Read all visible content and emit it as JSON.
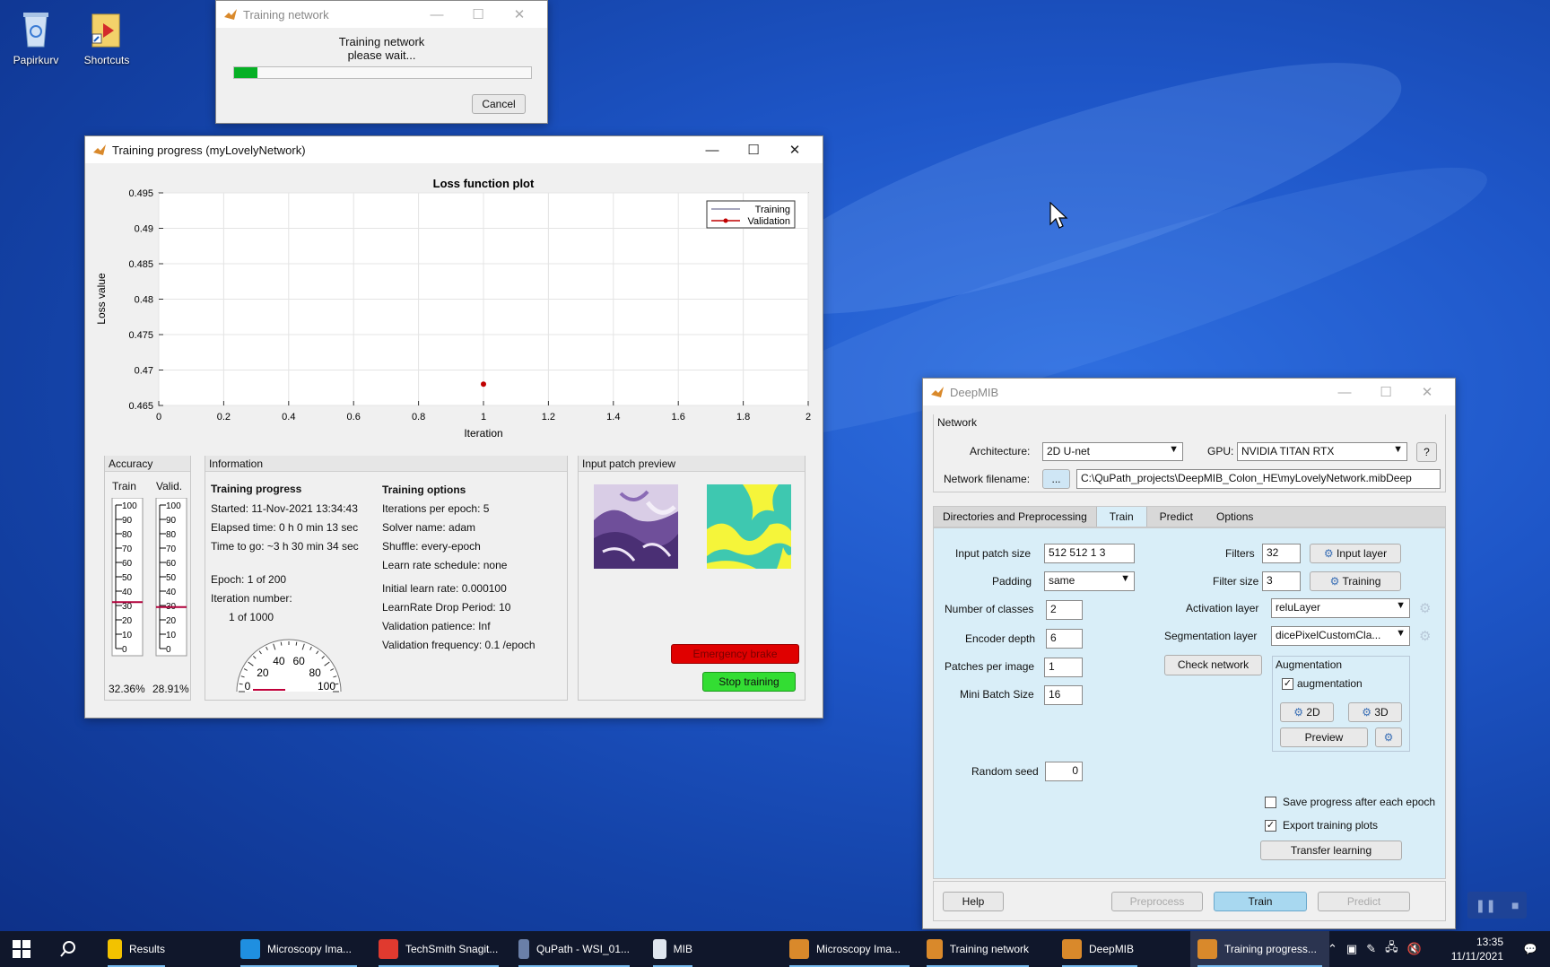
{
  "desktop": {
    "icons": [
      {
        "label": "Papirkurv"
      },
      {
        "label": "Shortcuts"
      }
    ]
  },
  "training_dialog": {
    "title": "Training network",
    "message_line1": "Training network",
    "message_line2": "please wait...",
    "progress": 0.08,
    "cancel_label": "Cancel"
  },
  "progress_window": {
    "title": "Training progress (myLovelyNetwork)",
    "plot_title": "Loss function plot",
    "chart_data": {
      "type": "scatter",
      "title": "Loss function plot",
      "xlabel": "Iteration",
      "ylabel": "Loss value",
      "xlim": [
        0,
        2
      ],
      "ylim": [
        0.465,
        0.495
      ],
      "xticks": [
        "0",
        "0.2",
        "0.4",
        "0.6",
        "0.8",
        "1",
        "1.2",
        "1.4",
        "1.6",
        "1.8",
        "2"
      ],
      "yticks": [
        "0.465",
        "0.47",
        "0.475",
        "0.48",
        "0.485",
        "0.49",
        "0.495"
      ],
      "grid": true,
      "legend_position": "top-right",
      "series": [
        {
          "name": "Training",
          "color": "#8a8aa8",
          "x": [],
          "y": []
        },
        {
          "name": "Validation",
          "color": "#c00000",
          "x": [
            1
          ],
          "y": [
            0.468
          ]
        }
      ]
    },
    "accuracy": {
      "title": "Accuracy",
      "train_label": "Train",
      "valid_label": "Valid.",
      "scale": [
        "100",
        "90",
        "80",
        "70",
        "60",
        "50",
        "40",
        "30",
        "20",
        "10",
        "0"
      ],
      "train_value": 32.36,
      "valid_value": 28.91,
      "train_text": "32.36%",
      "valid_text": "28.91%"
    },
    "information": {
      "title": "Information",
      "progress_heading": "Training progress",
      "started": "Started: 11-Nov-2021 13:34:43",
      "elapsed": "Elapsed time: 0 h 0 min 13 sec",
      "to_go": "Time to go: ~3 h 30 min 34 sec",
      "epoch": "Epoch: 1 of 200",
      "iteration_label": "Iteration number:",
      "iteration_value": "1 of 1000",
      "options_heading": "Training options",
      "iters_per_epoch": "Iterations per epoch: 5",
      "solver": "Solver name: adam",
      "shuffle": "Shuffle: every-epoch",
      "lr_schedule": "Learn rate schedule: none",
      "initial_lr": "Initial learn rate: 0.000100",
      "drop_period": "LearnRate Drop Period: 10",
      "patience": "Validation patience: Inf",
      "val_freq": "Validation frequency: 0.1 /epoch",
      "gauge_labels": [
        "0",
        "20",
        "40",
        "60",
        "80",
        "100"
      ]
    },
    "preview": {
      "title": "Input patch preview",
      "emergency_label": "Emergency brake",
      "stop_label": "Stop training"
    }
  },
  "deepmib": {
    "title": "DeepMIB",
    "network_section": "Network",
    "architecture_label": "Architecture:",
    "architecture_value": "2D U-net",
    "gpu_label": "GPU:",
    "gpu_value": "NVIDIA TITAN RTX",
    "help_q": "?",
    "filename_label": "Network filename:",
    "browse_label": "...",
    "filename_value": "C:\\QuPath_projects\\DeepMIB_Colon_HE\\myLovelyNetwork.mibDeep",
    "tabs": [
      "Directories and Preprocessing",
      "Train",
      "Predict",
      "Options"
    ],
    "train": {
      "input_patch_label": "Input patch size",
      "input_patch_value": "512 512 1 3",
      "padding_label": "Padding",
      "padding_value": "same",
      "classes_label": "Number of classes",
      "classes_value": "2",
      "encoder_label": "Encoder depth",
      "encoder_value": "6",
      "patches_label": "Patches per image",
      "patches_value": "1",
      "batch_label": "Mini Batch Size",
      "batch_value": "16",
      "seed_label": "Random seed",
      "seed_value": "0",
      "filters_label": "Filters",
      "filters_value": "32",
      "input_layer_label": "Input layer",
      "filter_size_label": "Filter size",
      "filter_size_value": "3",
      "training_label": "Training",
      "activation_label": "Activation layer",
      "activation_value": "reluLayer",
      "segmentation_label": "Segmentation layer",
      "segmentation_value": "dicePixelCustomCla...",
      "check_network_label": "Check network",
      "augmentation_title": "Augmentation",
      "augmentation_check_label": "augmentation",
      "aug2d_label": "2D",
      "aug3d_label": "3D",
      "preview_label": "Preview",
      "save_progress_label": "Save progress after each epoch",
      "export_plots_label": "Export training plots",
      "transfer_label": "Transfer learning"
    },
    "bottom": {
      "help": "Help",
      "preprocess": "Preprocess",
      "train": "Train",
      "predict": "Predict"
    }
  },
  "taskbar": {
    "items": [
      {
        "label": "Results",
        "color": "#f2c200"
      },
      {
        "label": "Microscopy Ima...",
        "color": "#1f8fe0"
      },
      {
        "label": "TechSmith Snagit...",
        "color": "#e03a2f"
      },
      {
        "label": "QuPath - WSI_01...",
        "color": "#6a7fa8"
      },
      {
        "label": "MIB",
        "color": "#dfe6f0"
      },
      {
        "label": "Microscopy Ima...",
        "color": "#d9892b"
      },
      {
        "label": "Training network",
        "color": "#d9892b"
      },
      {
        "label": "DeepMIB",
        "color": "#d9892b"
      },
      {
        "label": "Training progress...",
        "color": "#d9892b"
      }
    ],
    "time": "13:35",
    "date": "11/11/2021"
  },
  "colors": {
    "accent_green": "#33dd33",
    "emergency_red": "#e00000",
    "train_tab_blue": "#d9eef8",
    "train_button": "#a8d8f0"
  }
}
